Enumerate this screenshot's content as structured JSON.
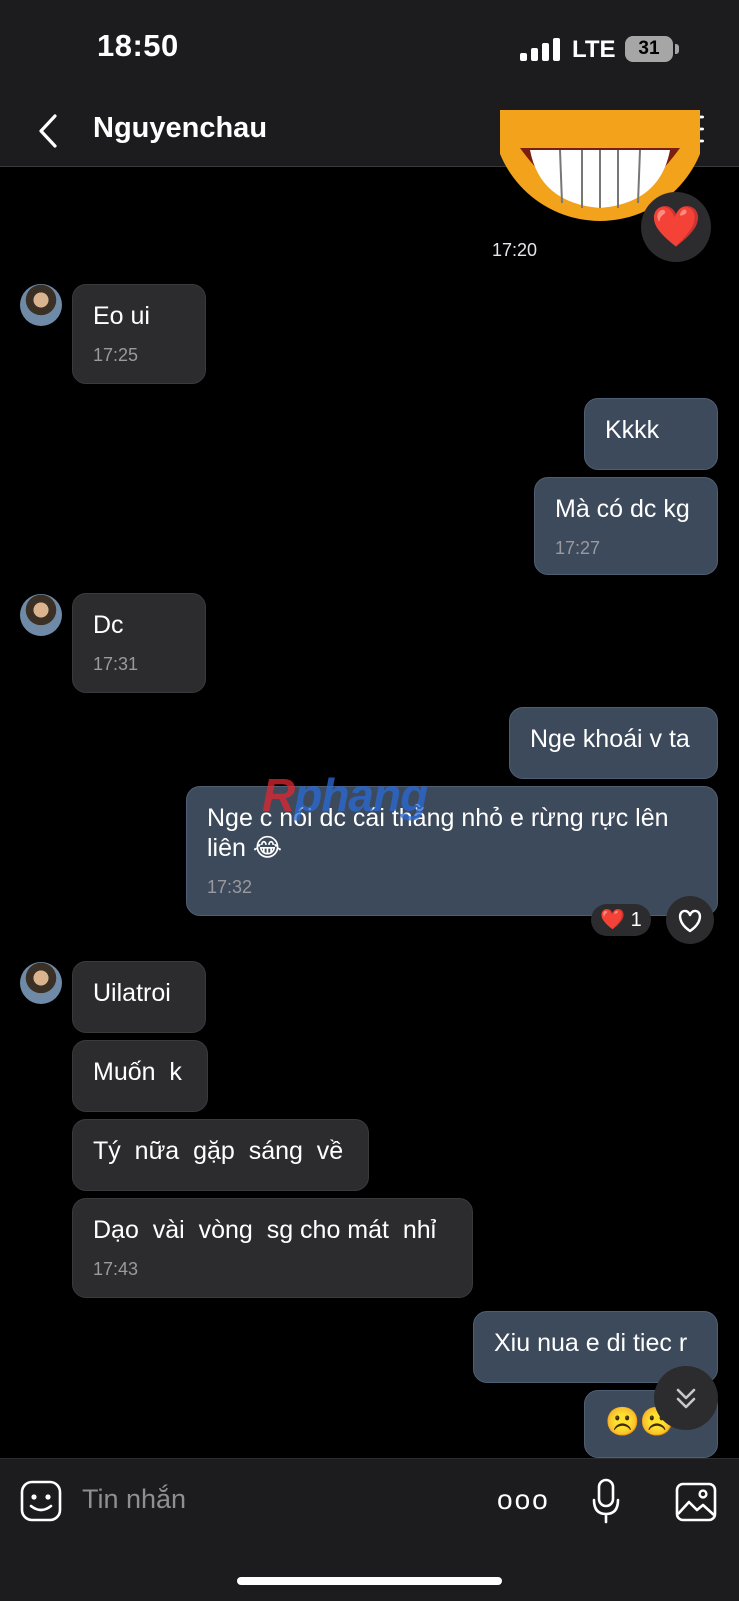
{
  "status_bar": {
    "time": "18:50",
    "network": "LTE",
    "battery": "31"
  },
  "header": {
    "contact_name": "Nguyenchau",
    "icons": [
      "back-icon",
      "phone-icon",
      "video-icon",
      "menu-icon"
    ]
  },
  "watermark": {
    "part1": "R",
    "part2": "phang"
  },
  "messages": {
    "m0": {
      "time": "17:20",
      "reaction": "❤️"
    },
    "m1": {
      "text": "Eo ui",
      "time": "17:25"
    },
    "m2": {
      "text": "Kkkk"
    },
    "m3": {
      "text": "Mà có dc kg",
      "time": "17:27"
    },
    "m4": {
      "text": "Dc",
      "time": "17:31"
    },
    "m5": {
      "text": "Nge khoái v ta"
    },
    "m6": {
      "line1": "Nge c nói dc cái thằng nhỏ e rừng rực lên",
      "line2": "liên 😂",
      "time": "17:32",
      "reaction": "❤️",
      "reaction_count": "1"
    },
    "m7": {
      "text": "Uilatroi"
    },
    "m8": {
      "text": "Muốn  k"
    },
    "m9": {
      "text": "Tý  nữa  gặp  sáng  về"
    },
    "m10": {
      "text": "Dạo  vài  vòng  sg cho mát  nhỉ",
      "time": "17:43"
    },
    "m11": {
      "text": "Xiu nua e di tiec r"
    },
    "m12": {
      "text": "☹️☹️"
    }
  },
  "input": {
    "placeholder": "Tin nhắn",
    "more": "ooo"
  },
  "colors": {
    "incoming": "#2c2c2e",
    "outgoing": "#3d4a5b",
    "background": "#000000",
    "bar": "#1c1c1e"
  }
}
